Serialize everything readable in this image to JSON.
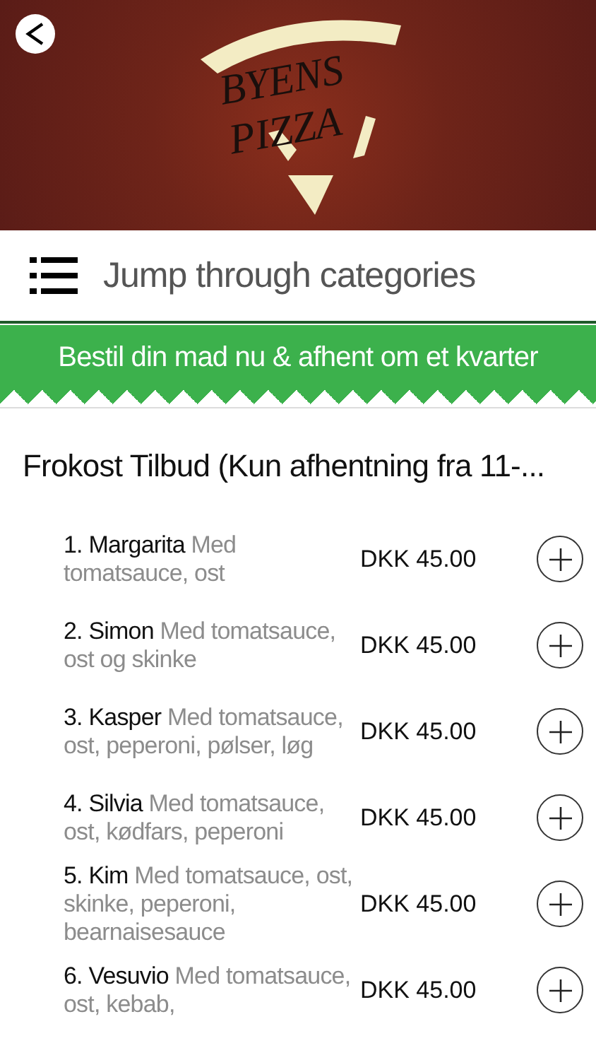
{
  "header": {
    "logo_line_1": "BYENS",
    "logo_line_2": "PIZZA"
  },
  "category_bar": {
    "label": "Jump through categories"
  },
  "banner": {
    "text": "Bestil din mad nu & afhent om et kvarter"
  },
  "section": {
    "title": "Frokost Tilbud (Kun afhentning fra 11-...",
    "items": [
      {
        "text": "**1. Margarita** Med tomatsauce, ost",
        "price": "DKK 45.00"
      },
      {
        "text": "**2. Simon** Med tomatsauce, ost og skinke",
        "price": "DKK 45.00"
      },
      {
        "text": "**3. Kasper** Med tomatsauce, ost, peperoni, pølser, løg",
        "price": "DKK 45.00"
      },
      {
        "text": "**4. Silvia** Med tomatsauce, ost, kødfars, peperoni",
        "price": "DKK 45.00"
      },
      {
        "text": "**5. Kim** Med tomatsauce, ost, skinke, peperoni, bearnaisesauce",
        "price": "DKK 45.00"
      },
      {
        "text": "**6. Vesuvio** Med tomatsauce, ost, kebab,",
        "price": "DKK 45.00"
      }
    ]
  }
}
